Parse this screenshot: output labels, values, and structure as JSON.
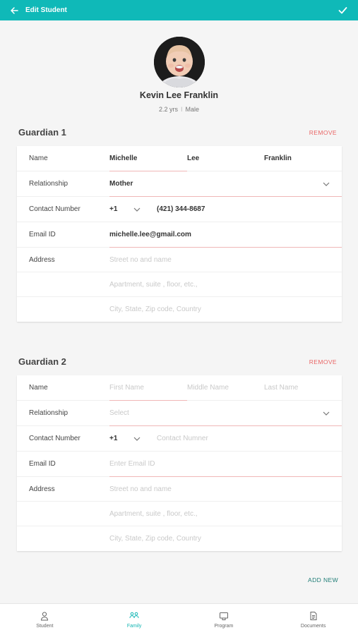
{
  "header": {
    "title": "Edit Student",
    "back_icon": "arrow-left-icon",
    "save_icon": "check-icon"
  },
  "student": {
    "name": "Kevin Lee Franklin",
    "age": "2.2 yrs",
    "separator": "I",
    "gender": "Male"
  },
  "guardian1": {
    "heading": "Guardian 1",
    "remove_label": "REMOVE",
    "labels": {
      "name": "Name",
      "relationship": "Relationship",
      "contact": "Contact Number",
      "email": "Email ID",
      "address": "Address"
    },
    "first_name": "Michelle",
    "middle_name": "Lee",
    "last_name": "Franklin",
    "relationship": "Mother",
    "country_code": "+1",
    "phone": "(421) 344-8687",
    "email": "michelle.lee@gmail.com",
    "address_line1_placeholder": "Street no and name",
    "address_line2_placeholder": "Apartment, suite , floor, etc.,",
    "address_line3_placeholder": "City, State, Zip code, Country"
  },
  "guardian2": {
    "heading": "Guardian 2",
    "remove_label": "REMOVE",
    "labels": {
      "name": "Name",
      "relationship": "Relationship",
      "contact": "Contact Number",
      "email": "Email ID",
      "address": "Address"
    },
    "first_name_placeholder": "First Name",
    "middle_name_placeholder": "Middle Name",
    "last_name_placeholder": "Last Name",
    "relationship_placeholder": "Select",
    "country_code": "+1",
    "phone_placeholder": "Contact Numner",
    "email_placeholder": "Enter Email ID",
    "address_line1_placeholder": "Street no and name",
    "address_line2_placeholder": "Apartment, suite , floor, etc.,",
    "address_line3_placeholder": "City, State, Zip code, Country"
  },
  "add_new_label": "ADD NEW",
  "nav": {
    "items": [
      {
        "label": "Student",
        "icon": "person-icon"
      },
      {
        "label": "Family",
        "icon": "family-icon"
      },
      {
        "label": "Program",
        "icon": "program-icon"
      },
      {
        "label": "Documents",
        "icon": "document-icon"
      }
    ],
    "active": "Family"
  },
  "colors": {
    "accent": "#0fb9b8",
    "remove": "#e96666",
    "add_new": "#1f7d76",
    "underline": "#f0b7b7"
  }
}
